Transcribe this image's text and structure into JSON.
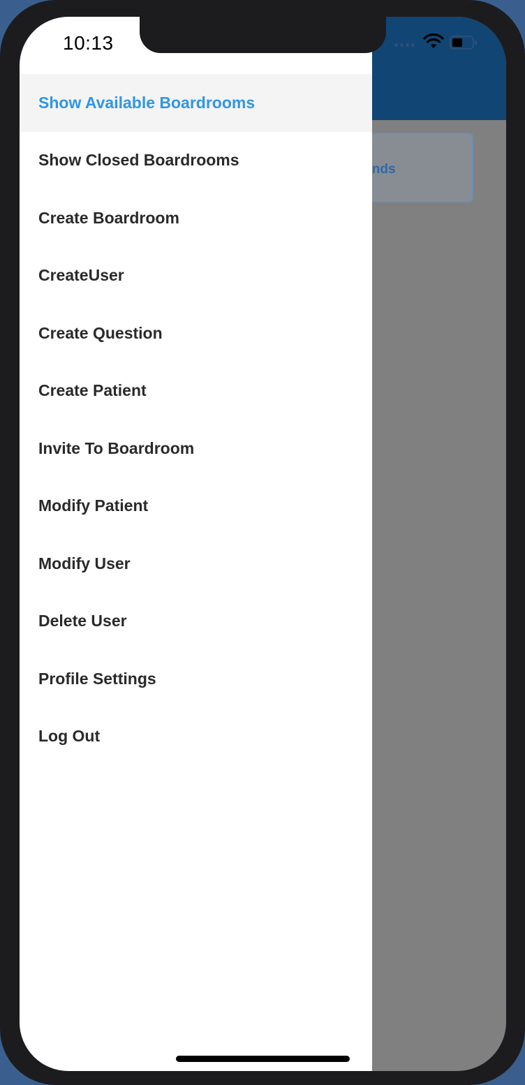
{
  "status_bar": {
    "time": "10:13"
  },
  "background_app": {
    "card_text": "econds",
    "header_color": "#114574",
    "accent_color": "#2f67a5"
  },
  "drawer": {
    "active_color": "#2f96e6",
    "items": [
      {
        "label": "Show Available Boardrooms",
        "active": true
      },
      {
        "label": "Show Closed Boardrooms"
      },
      {
        "label": "Create Boardroom"
      },
      {
        "label": "CreateUser"
      },
      {
        "label": "Create Question"
      },
      {
        "label": "Create Patient"
      },
      {
        "label": "Invite To Boardroom"
      },
      {
        "label": "Modify Patient"
      },
      {
        "label": "Modify User"
      },
      {
        "label": "Delete User"
      },
      {
        "label": "Profile Settings"
      },
      {
        "label": "Log Out"
      }
    ]
  },
  "icons": {
    "signal": "signal-dots-icon",
    "wifi": "wifi-icon",
    "battery": "battery-icon"
  }
}
